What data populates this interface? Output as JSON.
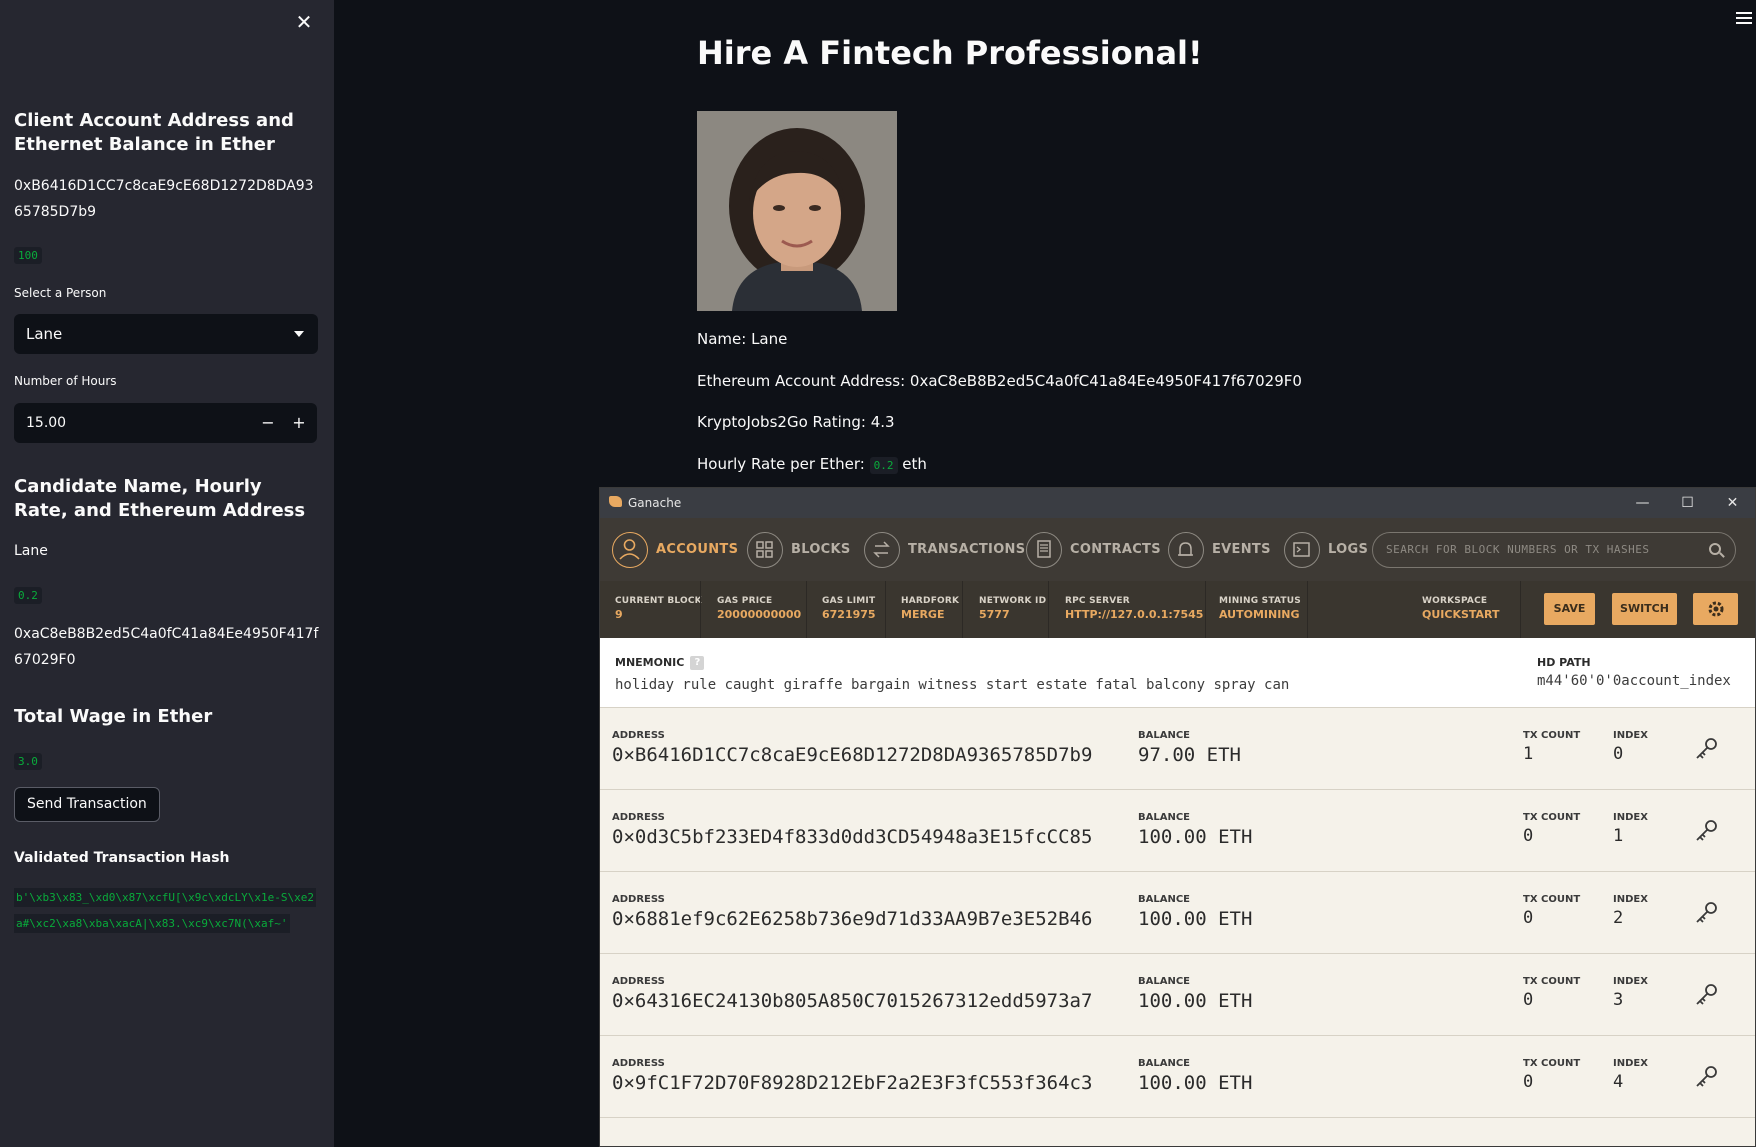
{
  "sidebar": {
    "close": "✕",
    "client_heading": "Client Account Address and Ethernet Balance in Ether",
    "client_address": "0xB6416D1CC7c8caE9cE68D1272D8DA9365785D7b9",
    "client_balance": "100",
    "select_label": "Select a Person",
    "select_value": "Lane",
    "hours_label": "Number of Hours",
    "hours_value": "15.00",
    "minus": "−",
    "plus": "+",
    "candidate_heading": "Candidate Name, Hourly Rate, and Ethereum Address",
    "candidate_name": "Lane",
    "candidate_rate": "0.2",
    "candidate_address": "0xaC8eB8B2ed5C4a0fC41a84Ee4950F417f67029F0",
    "wage_heading": "Total Wage in Ether",
    "wage_value": "3.0",
    "send_button": "Send Transaction",
    "hash_heading": "Validated Transaction Hash",
    "hash_value": "b'\\xb3\\x83_\\xd0\\x87\\xcfU[\\x9c\\xdcLY\\x1e-S\\xe2a#\\xc2\\xa8\\xba\\xacA|\\x83.\\xc9\\xc7N(\\xaf~'"
  },
  "main": {
    "title": "Hire A Fintech Professional!",
    "name_line": "Name: Lane",
    "address_line": "Ethereum Account Address: 0xaC8eB8B2ed5C4a0fC41a84Ee4950F417f67029F0",
    "rating_line": "KryptoJobs2Go Rating: 4.3",
    "rate_prefix": "Hourly Rate per Ether:",
    "rate_value": "0.2",
    "rate_suffix": "eth"
  },
  "ganache": {
    "title": "Ganache",
    "nav": [
      {
        "label": "ACCOUNTS",
        "icon": "user-icon"
      },
      {
        "label": "BLOCKS",
        "icon": "grid-icon"
      },
      {
        "label": "TRANSACTIONS",
        "icon": "swap-icon"
      },
      {
        "label": "CONTRACTS",
        "icon": "document-icon"
      },
      {
        "label": "EVENTS",
        "icon": "bell-icon"
      },
      {
        "label": "LOGS",
        "icon": "terminal-icon"
      }
    ],
    "search_placeholder": "SEARCH FOR BLOCK NUMBERS OR TX HASHES",
    "stats": [
      {
        "k": "CURRENT BLOCK",
        "v": "9"
      },
      {
        "k": "GAS PRICE",
        "v": "20000000000"
      },
      {
        "k": "GAS LIMIT",
        "v": "6721975"
      },
      {
        "k": "HARDFORK",
        "v": "MERGE"
      },
      {
        "k": "NETWORK ID",
        "v": "5777"
      },
      {
        "k": "RPC SERVER",
        "v": "HTTP://127.0.0.1:7545"
      },
      {
        "k": "MINING STATUS",
        "v": "AUTOMINING"
      }
    ],
    "workspace_label": "WORKSPACE",
    "workspace_value": "QUICKSTART",
    "save": "SAVE",
    "switch": "SWITCH",
    "mnemonic_label": "MNEMONIC",
    "mnemonic_q": "?",
    "mnemonic_value": "holiday rule caught giraffe bargain witness start estate fatal balcony spray can",
    "hdpath_label": "HD PATH",
    "hdpath_value": "m44'60'0'0account_index",
    "col_address": "ADDRESS",
    "col_balance": "BALANCE",
    "col_tx": "TX COUNT",
    "col_index": "INDEX",
    "accounts": [
      {
        "address": "0×B6416D1CC7c8caE9cE68D1272D8DA9365785D7b9",
        "balance": "97.00 ETH",
        "tx": "1",
        "index": "0"
      },
      {
        "address": "0×0d3C5bf233ED4f833d0dd3CD54948a3E15fcCC85",
        "balance": "100.00 ETH",
        "tx": "0",
        "index": "1"
      },
      {
        "address": "0×6881ef9c62E6258b736e9d71d33AA9B7e3E52B46",
        "balance": "100.00 ETH",
        "tx": "0",
        "index": "2"
      },
      {
        "address": "0×64316EC24130b805A850C7015267312edd5973a7",
        "balance": "100.00 ETH",
        "tx": "0",
        "index": "3"
      },
      {
        "address": "0×9fC1F72D70F8928D212EbF2a2E3F3fC553f364c3",
        "balance": "100.00 ETH",
        "tx": "0",
        "index": "4"
      }
    ]
  }
}
